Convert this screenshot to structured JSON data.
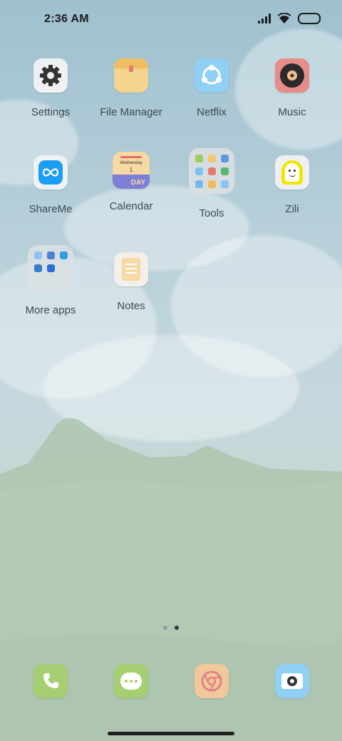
{
  "status_bar": {
    "time": "2:36 AM",
    "icons": [
      "signal-icon",
      "wifi-icon",
      "battery-icon"
    ]
  },
  "apps": [
    {
      "label": "Settings",
      "icon": "gear-icon"
    },
    {
      "label": "File Manager",
      "icon": "folder-icon"
    },
    {
      "label": "Netflix",
      "icon": "share-icon"
    },
    {
      "label": "Music",
      "icon": "vinyl-icon"
    },
    {
      "label": "ShareMe",
      "icon": "infinity-icon"
    },
    {
      "label": "Calendar",
      "icon": "calendar-icon",
      "day_name": "Wednesday",
      "day_num": "1",
      "day_word": "DAY"
    },
    {
      "label": "Tools",
      "icon": "folder-tools-icon"
    },
    {
      "label": "Zili",
      "icon": "zili-icon"
    },
    {
      "label": "More apps",
      "icon": "folder-more-icon"
    },
    {
      "label": "Notes",
      "icon": "notes-icon"
    }
  ],
  "page_indicator": {
    "pages": 2,
    "active": 2
  },
  "dock": [
    {
      "name": "phone",
      "icon": "phone-icon"
    },
    {
      "name": "messages",
      "icon": "message-icon"
    },
    {
      "name": "browser",
      "icon": "browser-icon"
    },
    {
      "name": "camera",
      "icon": "camera-icon"
    }
  ],
  "colors": {
    "wallpaper_top": "#9fc0cf",
    "wallpaper_bottom": "#b7cab8",
    "label": "#3c4a52"
  }
}
